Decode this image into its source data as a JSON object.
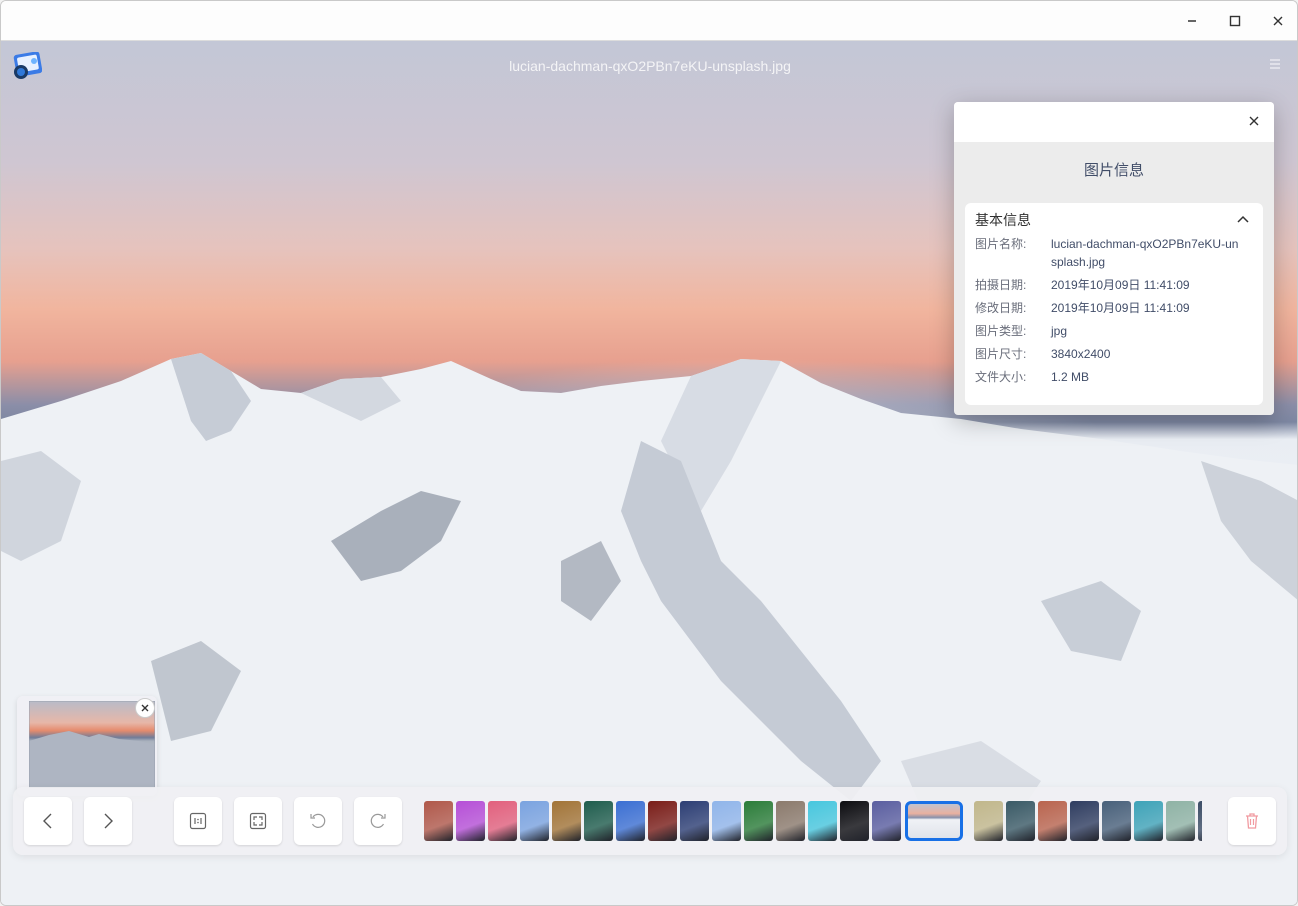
{
  "window": {
    "file_title": "lucian-dachman-qxO2PBn7eKU-unsplash.jpg",
    "controls": [
      "minimize",
      "maximize",
      "close"
    ]
  },
  "info_panel": {
    "title": "图片信息",
    "section_title": "基本信息",
    "rows": [
      {
        "key": "图片名称:",
        "value": "lucian-dachman-qxO2PBn7eKU-unsplash.jpg"
      },
      {
        "key": "拍摄日期:",
        "value": "2019年10月09日 11:41:09"
      },
      {
        "key": "修改日期:",
        "value": "2019年10月09日 11:41:09"
      },
      {
        "key": "图片类型:",
        "value": "jpg"
      },
      {
        "key": "图片尺寸:",
        "value": "3840x2400"
      },
      {
        "key": "文件大小:",
        "value": "1.2 MB"
      }
    ]
  },
  "toolbar": {
    "buttons": [
      "previous",
      "next",
      "original-size",
      "fit-window",
      "rotate-left",
      "rotate-right",
      "delete"
    ],
    "thumbnail_colors": [
      "#b0584a",
      "#b64fd7",
      "#e2607d",
      "#7aa3e0",
      "#a27437",
      "#1f5d4d",
      "#3b6fd3",
      "#7a1d18",
      "#2c3e74",
      "#90b5ea",
      "#2b7d39",
      "#8b7a6c",
      "#47c7de",
      "#0c0c10",
      "#5a5ea0",
      "#c1b78b",
      "#3a5a66",
      "#b9644e",
      "#2f3d60",
      "#48607a",
      "#3ea3b8",
      "#8fb3a5",
      "#3c4d66"
    ]
  }
}
